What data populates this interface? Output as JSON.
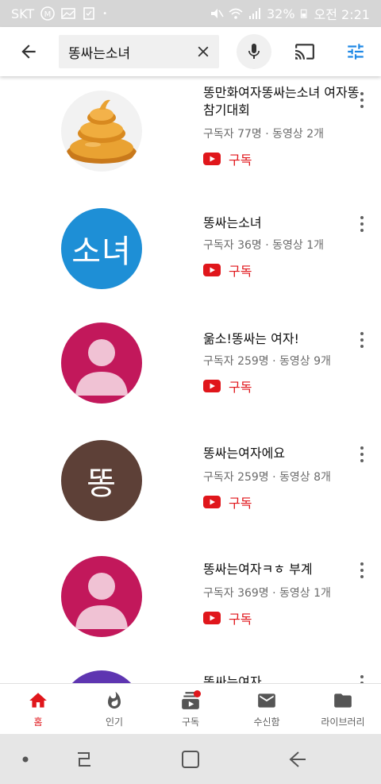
{
  "status_bar": {
    "carrier": "SKT",
    "battery": "32%",
    "time": "오전 2:21"
  },
  "search": {
    "query": "똥싸는소녀",
    "icons": [
      "back-arrow-icon",
      "clear-icon",
      "mic-icon",
      "cast-icon",
      "filter-icon"
    ]
  },
  "results": [
    {
      "name": "똥만화여자똥싸는소녀 여자똥참기대회",
      "meta": "구독자 77명 · 동영상 2개",
      "subscribe": "구독",
      "avatar_type": "poop",
      "avatar_color": "#e59a2a"
    },
    {
      "name": "똥싸는소녀",
      "meta": "구독자 36명 · 동영상 1개",
      "subscribe": "구독",
      "avatar_type": "text",
      "avatar_text": "소녀",
      "avatar_color": "#1e8fd6"
    },
    {
      "name": "욺소!똥싸는 여자!",
      "meta": "구독자 259명 · 동영상 9개",
      "subscribe": "구독",
      "avatar_type": "person",
      "avatar_color": "#c2185b"
    },
    {
      "name": "똥싸는여자에요",
      "meta": "구독자 259명 · 동영상 8개",
      "subscribe": "구독",
      "avatar_type": "text",
      "avatar_text": "똥",
      "avatar_color": "#5d4037"
    },
    {
      "name": "똥싸는여자ㅋㅎ 부계",
      "meta": "구독자 369명 · 동영상 1개",
      "subscribe": "구독",
      "avatar_type": "person",
      "avatar_color": "#c2185b"
    },
    {
      "name": "똥싸는여자",
      "meta": "",
      "subscribe": "",
      "avatar_type": "partial",
      "avatar_color": "#5e35b1"
    }
  ],
  "bottom_nav": {
    "items": [
      {
        "label": "홈",
        "icon": "home-icon",
        "active": true
      },
      {
        "label": "인기",
        "icon": "trending-icon",
        "active": false
      },
      {
        "label": "구독",
        "icon": "subscriptions-icon",
        "active": false
      },
      {
        "label": "수신함",
        "icon": "inbox-icon",
        "active": false
      },
      {
        "label": "라이브러리",
        "icon": "library-icon",
        "active": false
      }
    ]
  },
  "colors": {
    "accent": "#e0161b",
    "filter_blue": "#1e88e5",
    "status_bar": "#d6d6d6"
  }
}
